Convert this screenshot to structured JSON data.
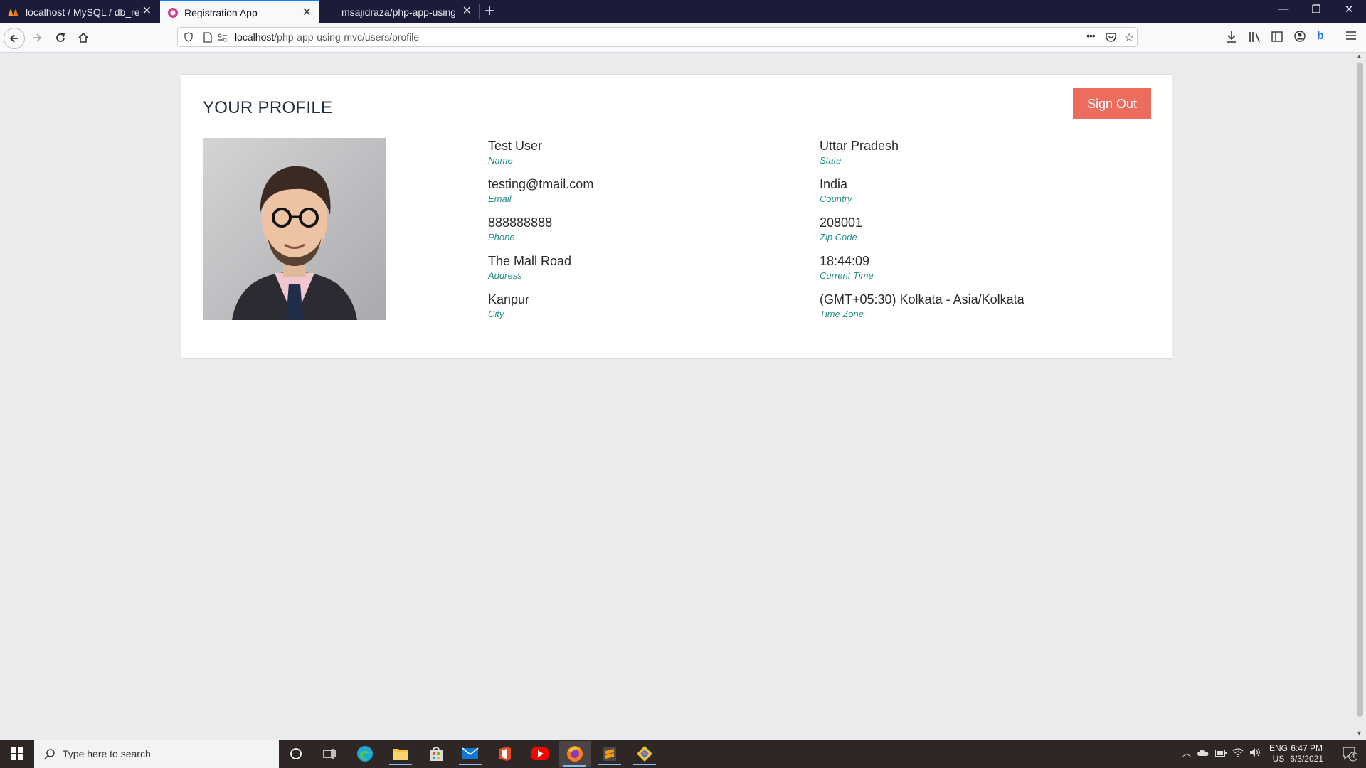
{
  "browser": {
    "tabs": [
      {
        "title": "localhost / MySQL / db_reg",
        "active": false,
        "icon": "phpmyadmin-icon"
      },
      {
        "title": "Registration App",
        "active": true,
        "icon": "app-icon"
      },
      {
        "title": "msajidraza/php-app-using-",
        "active": false,
        "icon": "github-icon"
      }
    ],
    "url_host": "localhost",
    "url_path": "/php-app-using-mvc/users/profile",
    "url_menu": "•••"
  },
  "page": {
    "title": "YOUR PROFILE",
    "sign_out_label": "Sign Out",
    "left_fields": [
      {
        "value": "Test User",
        "label": "Name"
      },
      {
        "value": "testing@tmail.com",
        "label": "Email"
      },
      {
        "value": "888888888",
        "label": "Phone"
      },
      {
        "value": "The Mall Road",
        "label": "Address"
      },
      {
        "value": "Kanpur",
        "label": "City"
      }
    ],
    "right_fields": [
      {
        "value": "Uttar Pradesh",
        "label": "State"
      },
      {
        "value": "India",
        "label": "Country"
      },
      {
        "value": "208001",
        "label": "Zip Code"
      },
      {
        "value": "18:44:09",
        "label": "Current Time"
      },
      {
        "value": "(GMT+05:30) Kolkata - Asia/Kolkata",
        "label": "Time Zone"
      }
    ]
  },
  "taskbar": {
    "search_placeholder": "Type here to search",
    "lang_top": "ENG",
    "lang_bottom": "US",
    "time": "6:47 PM",
    "date": "6/3/2021",
    "notification_count": "4"
  },
  "colors": {
    "accent_button": "#ec6c5d",
    "label_teal": "#2a8f8a",
    "tab_bar": "#1c1b3a"
  }
}
